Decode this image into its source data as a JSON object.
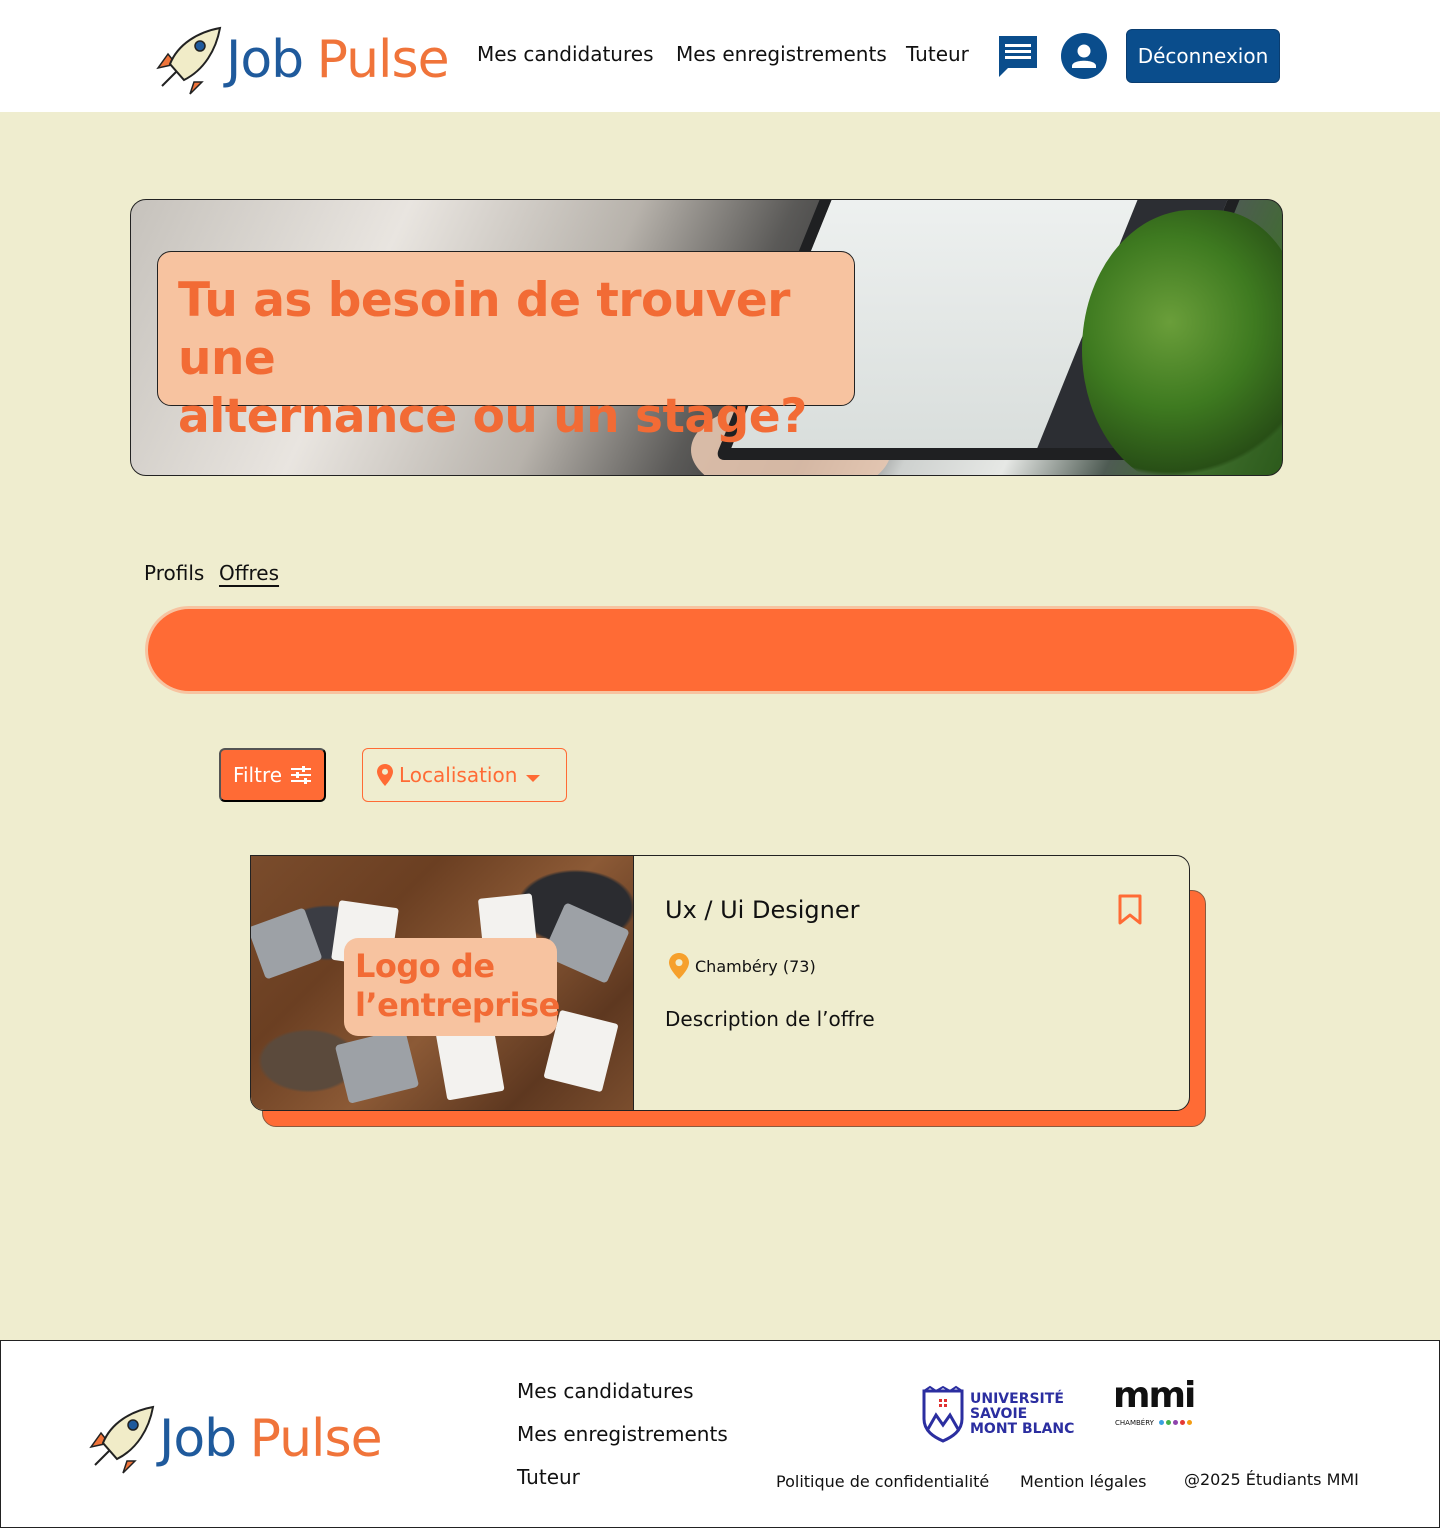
{
  "header": {
    "logo": {
      "job": "Job",
      "pulse": "Pulse"
    },
    "nav": [
      "Mes candidatures",
      "Mes enregistrements",
      "Tuteur"
    ],
    "logout_label": "Déconnexion",
    "icons": {
      "messages": "chat-icon",
      "profile": "user-icon",
      "logo": "rocket-icon"
    }
  },
  "hero": {
    "line1": "Tu as besoin de trouver une",
    "line2": "alternance ou un stage?"
  },
  "tabs": {
    "profils": "Profils",
    "offres": "Offres",
    "active": "Offres"
  },
  "search": {
    "value": ""
  },
  "filters": {
    "filter_label": "Filtre",
    "location_label": "Localisation",
    "icons": {
      "filter": "sliders-icon",
      "location": "map-pin-icon",
      "dropdown": "caret-down-icon"
    }
  },
  "offer": {
    "title": "Ux / Ui Designer",
    "logo_line1": "Logo de",
    "logo_line2": "l’entreprise",
    "location": "Chambéry (73)",
    "description": "Description de l’offre",
    "icons": {
      "bookmark": "bookmark-icon",
      "location": "map-pin-icon"
    }
  },
  "footer": {
    "logo": {
      "job": "Job",
      "pulse": "Pulse"
    },
    "links": [
      "Mes candidatures",
      "Mes enregistrements",
      "Tuteur"
    ],
    "usmb": {
      "line1": "UNIVERSITÉ",
      "line2": "SAVOIE",
      "line3": "MONT BLANC"
    },
    "mmi": {
      "name": "mmi",
      "sub": "CHAMBÉRY"
    },
    "privacy": "Politique de confidentialité",
    "legal": "Mention légales",
    "copyright": "@2025 Étudiants MMI"
  },
  "colors": {
    "background": "#efedcf",
    "accent_orange": "#ff6b35",
    "peach": "#f7c3a0",
    "brand_blue": "#0a4d8c",
    "logo_blue": "#1f5a9c"
  }
}
